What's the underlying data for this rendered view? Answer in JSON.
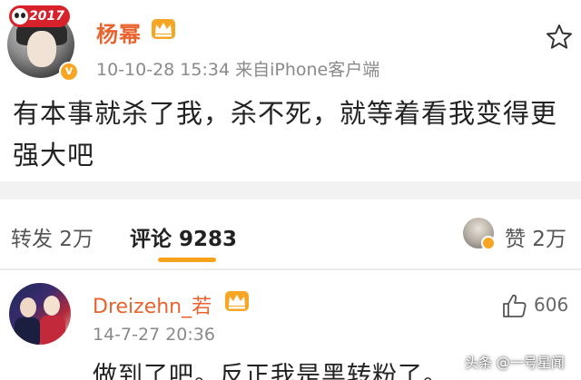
{
  "post": {
    "badge": "2017",
    "username": "杨幂",
    "timestamp": "10-10-28 15:34  来自iPhone客户端",
    "content": "有本事就杀了我，杀不死，就等着看我变得更强大吧"
  },
  "actions": {
    "repost": "转发 2万",
    "comment": "评论 9283",
    "like": "赞 2万"
  },
  "comment": {
    "username": "Dreizehn_若",
    "date": "14-7-27 20:36",
    "like_count": "606",
    "text": "做到了吧。反正我是黑转粉了。"
  },
  "watermark": "头条 @一号星闻",
  "colors": {
    "username": "#e8632e",
    "accent_underline": "#f7a21b",
    "badge_red": "#d8222b",
    "verified": "#f6a623"
  },
  "icons": [
    "star-icon",
    "crown-icon",
    "verified-icon",
    "thumbs-up-icon"
  ]
}
